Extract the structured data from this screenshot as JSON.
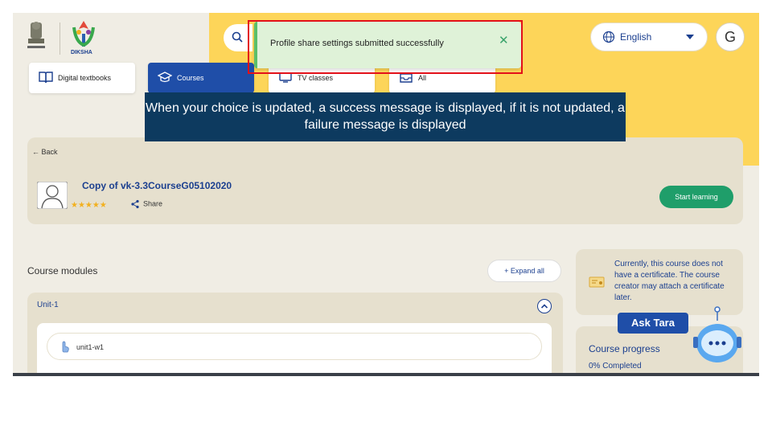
{
  "brand": {
    "name": "DIKSHA"
  },
  "header": {
    "language": "English",
    "avatar_initial": "G"
  },
  "tabs": [
    {
      "label": "Digital textbooks",
      "icon": "book-icon",
      "active": false
    },
    {
      "label": "Courses",
      "icon": "graduation-cap-icon",
      "active": true
    },
    {
      "label": "TV classes",
      "icon": "tv-icon",
      "active": false
    },
    {
      "label": "All",
      "icon": "inbox-icon",
      "active": false
    }
  ],
  "toast": {
    "message": "Profile share settings submitted successfully",
    "close": "✕"
  },
  "callout": {
    "text": "When your choice is updated, a success message is displayed, if it is not updated, a failure message is displayed"
  },
  "course": {
    "back_label": "Back",
    "title": "Copy of vk-3.3CourseG05102020",
    "rating": "★★★★★",
    "share_label": "Share",
    "start_label": "Start learning"
  },
  "modules": {
    "heading": "Course modules",
    "expand_label": "Expand all",
    "unit_title": "Unit-1",
    "items": [
      {
        "label": "unit1-w1"
      }
    ]
  },
  "certificate": {
    "text": "Currently, this course does not have a certificate. The course creator may attach a certificate later."
  },
  "progress": {
    "title": "Course progress",
    "value": "0% Completed"
  },
  "assistant": {
    "label": "Ask Tara"
  },
  "colors": {
    "accent": "#1f4ea8",
    "primary_button": "#1f9e6a",
    "header_yellow": "#fdd559",
    "toast_bg": "#dff2d8",
    "highlight": "#e3111a"
  }
}
